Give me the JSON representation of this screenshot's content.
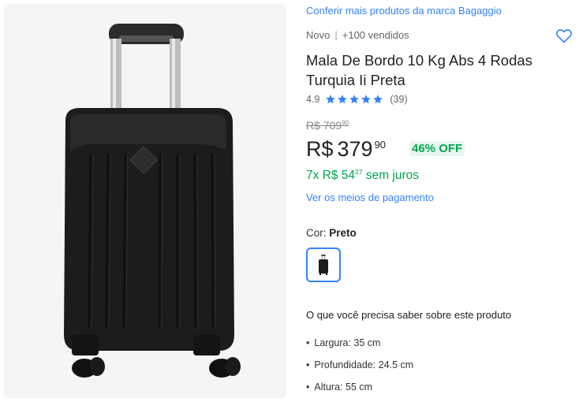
{
  "brand_link": "Conferir mais produtos da marca Bagaggio",
  "condition": "Novo",
  "sold": "+100 vendidos",
  "title": "Mala De Bordo 10 Kg Abs 4 Rodas Turquia Ii Preta",
  "rating": {
    "score": "4.9",
    "count": "(39)",
    "stars": 5
  },
  "old_price": {
    "currency": "R$",
    "int": "709",
    "cents": "90"
  },
  "price": {
    "currency": "R$",
    "int": "379",
    "cents": "90"
  },
  "discount": "46% OFF",
  "installments": {
    "prefix": "7x R$ 54",
    "cents": "27",
    "suffix": "sem juros"
  },
  "payment_link": "Ver os meios de pagamento",
  "color": {
    "label": "Cor:",
    "value": "Preto"
  },
  "specs": {
    "title": "O que você precisa saber sobre este produto",
    "items": [
      "Largura: 35 cm",
      "Profundidade: 24.5 cm",
      "Altura: 55 cm"
    ]
  },
  "colors": {
    "accent": "#3483fa",
    "green": "#00a650",
    "star": "#3483fa"
  }
}
